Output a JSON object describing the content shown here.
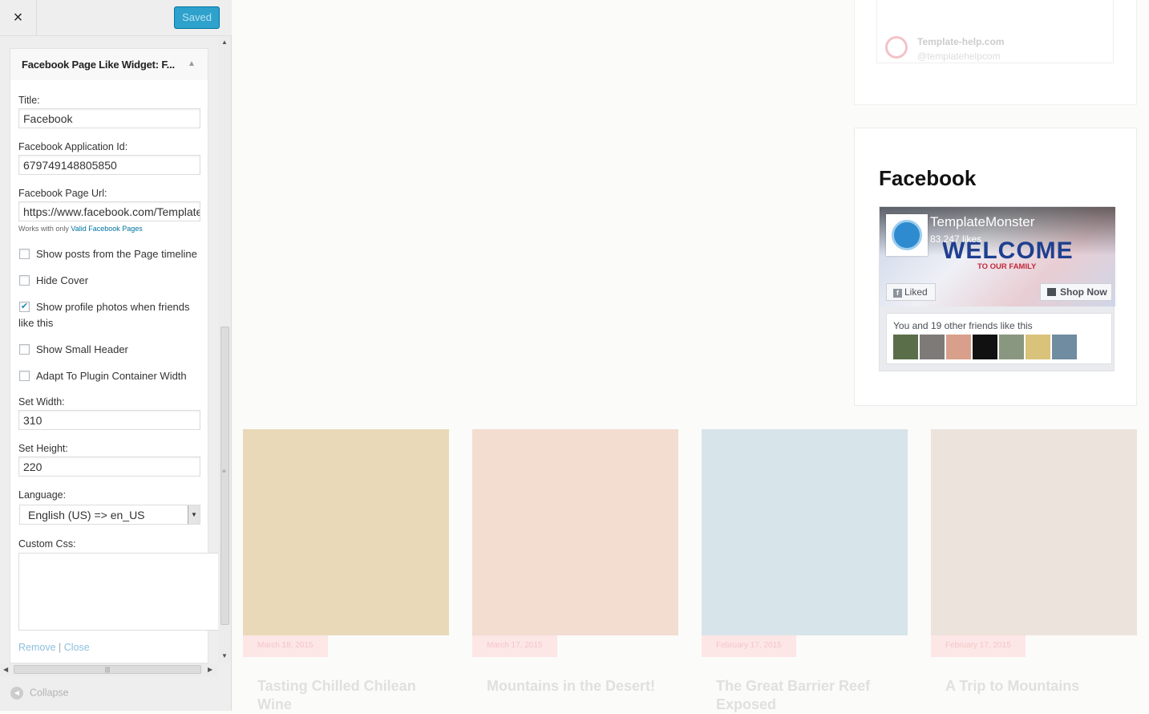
{
  "header": {
    "close_label": "×",
    "saved_label": "Saved"
  },
  "widget": {
    "title_bar": "Facebook Page Like Widget: F..."
  },
  "form": {
    "title_label": "Title:",
    "title_value": "Facebook",
    "app_id_label": "Facebook Application Id:",
    "app_id_value": "679749148805850",
    "page_url_label": "Facebook Page Url:",
    "page_url_value": "https://www.facebook.com/TemplateMonster",
    "note_prefix": "Works with only",
    "note_link": "Valid Facebook Pages",
    "checkboxes": [
      {
        "label": "Show posts from the Page timeline",
        "checked": false
      },
      {
        "label": "Hide Cover",
        "checked": false
      },
      {
        "label": "Show profile photos when friends like this",
        "checked": true
      },
      {
        "label": "Show Small Header",
        "checked": false
      },
      {
        "label": "Adapt To Plugin Container Width",
        "checked": false
      }
    ],
    "width_label": "Set Width:",
    "width_value": "310",
    "height_label": "Set Height:",
    "height_value": "220",
    "language_label": "Language:",
    "language_value": "English (US) => en_US",
    "custom_css_label": "Custom Css:",
    "remove_label": "Remove",
    "separator": "|",
    "close_label": "Close"
  },
  "footer": {
    "collapse_label": "Collapse"
  },
  "preview": {
    "twitter": {
      "name": "Template-help.com",
      "handle": "@templatehelpcom"
    },
    "facebook_heading": "Facebook",
    "fb_widget": {
      "page_name": "TemplateMonster",
      "likes": "83,247 likes",
      "welcome": "WELCOME",
      "welcome_sub": "TO OUR FAMILY",
      "liked_label": "Liked",
      "shop_label": "Shop Now",
      "friends_text": "You and 19 other friends like this",
      "friend_colors": [
        "#5b6e4a",
        "#7d7a78",
        "#d8a08a",
        "#111111",
        "#8a9780",
        "#d9c27a",
        "#6f8ca0"
      ]
    },
    "posts": [
      {
        "date": "March 18, 2015",
        "title": "Tasting Chilled Chilean Wine",
        "color": "#e9d9b8"
      },
      {
        "date": "March 17, 2015",
        "title": "Mountains in the Desert!",
        "color": "#f3dcd0"
      },
      {
        "date": "February 17, 2015",
        "title": "The Great Barrier Reef Exposed",
        "color": "#d7e4ea"
      },
      {
        "date": "February 17, 2015",
        "title": "A Trip to Mountains",
        "color": "#ece3dc"
      }
    ]
  }
}
